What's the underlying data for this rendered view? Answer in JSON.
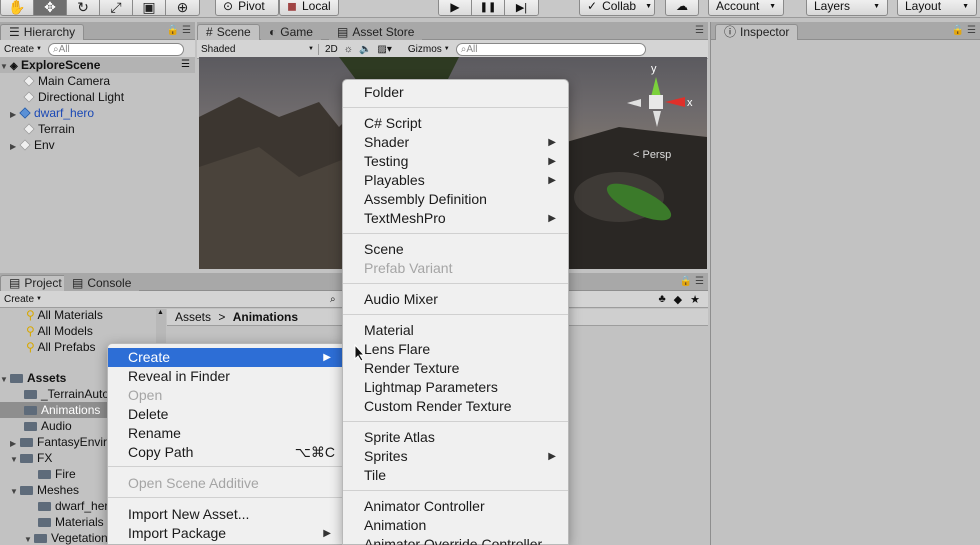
{
  "toolbar": {
    "pivot": "Pivot",
    "local": "Local",
    "collab": "Collab",
    "account": "Account",
    "layers": "Layers",
    "layout": "Layout"
  },
  "hierarchy": {
    "tab": "Hierarchy",
    "create": "Create",
    "search_placeholder": "All",
    "scene": "ExploreScene",
    "items": [
      "Main Camera",
      "Directional Light",
      "dwarf_hero",
      "Terrain",
      "Env"
    ]
  },
  "scene_panel": {
    "tabs": [
      "Scene",
      "Game",
      "Asset Store"
    ],
    "shading": "Shaded",
    "mode_2d": "2D",
    "gizmos": "Gizmos",
    "search_placeholder": "All",
    "gizmo_y": "y",
    "gizmo_x": "x",
    "persp": "< Persp"
  },
  "inspector": {
    "tab": "Inspector"
  },
  "project": {
    "tabs": [
      "Project",
      "Console"
    ],
    "create": "Create",
    "favorites": [
      "All Materials",
      "All Models",
      "All Prefabs"
    ],
    "assets_label": "Assets",
    "tree": [
      "_TerrainAuto",
      "Animations",
      "Audio",
      "FantasyEnvir",
      "FX",
      "Fire",
      "Meshes",
      "dwarf_her",
      "Materials",
      "Vegetation"
    ],
    "breadcrumb": [
      "Assets",
      "Animations"
    ]
  },
  "context_menu": [
    {
      "label": "Create",
      "highlight": true,
      "submenu": true
    },
    {
      "label": "Reveal in Finder"
    },
    {
      "label": "Open",
      "disabled": true
    },
    {
      "label": "Delete"
    },
    {
      "label": "Rename"
    },
    {
      "label": "Copy Path",
      "shortcut": "⌥⌘C"
    },
    {
      "label": "Open Scene Additive",
      "disabled": true
    },
    {
      "label": "Import New Asset..."
    },
    {
      "label": "Import Package",
      "submenu": true
    }
  ],
  "create_menu": [
    {
      "label": "Folder"
    },
    {
      "label": "C# Script"
    },
    {
      "label": "Shader",
      "submenu": true
    },
    {
      "label": "Testing",
      "submenu": true
    },
    {
      "label": "Playables",
      "submenu": true
    },
    {
      "label": "Assembly Definition"
    },
    {
      "label": "TextMeshPro",
      "submenu": true
    },
    {
      "label": "Scene"
    },
    {
      "label": "Prefab Variant",
      "disabled": true
    },
    {
      "label": "Audio Mixer"
    },
    {
      "label": "Material"
    },
    {
      "label": "Lens Flare"
    },
    {
      "label": "Render Texture"
    },
    {
      "label": "Lightmap Parameters"
    },
    {
      "label": "Custom Render Texture"
    },
    {
      "label": "Sprite Atlas"
    },
    {
      "label": "Sprites",
      "submenu": true
    },
    {
      "label": "Tile"
    },
    {
      "label": "Animator Controller"
    },
    {
      "label": "Animation"
    },
    {
      "label": "Animator Override Controller"
    }
  ],
  "icons": {
    "submenu_arrow": "▶",
    "play": "▶",
    "pause": "❚❚",
    "step": "▶|"
  }
}
